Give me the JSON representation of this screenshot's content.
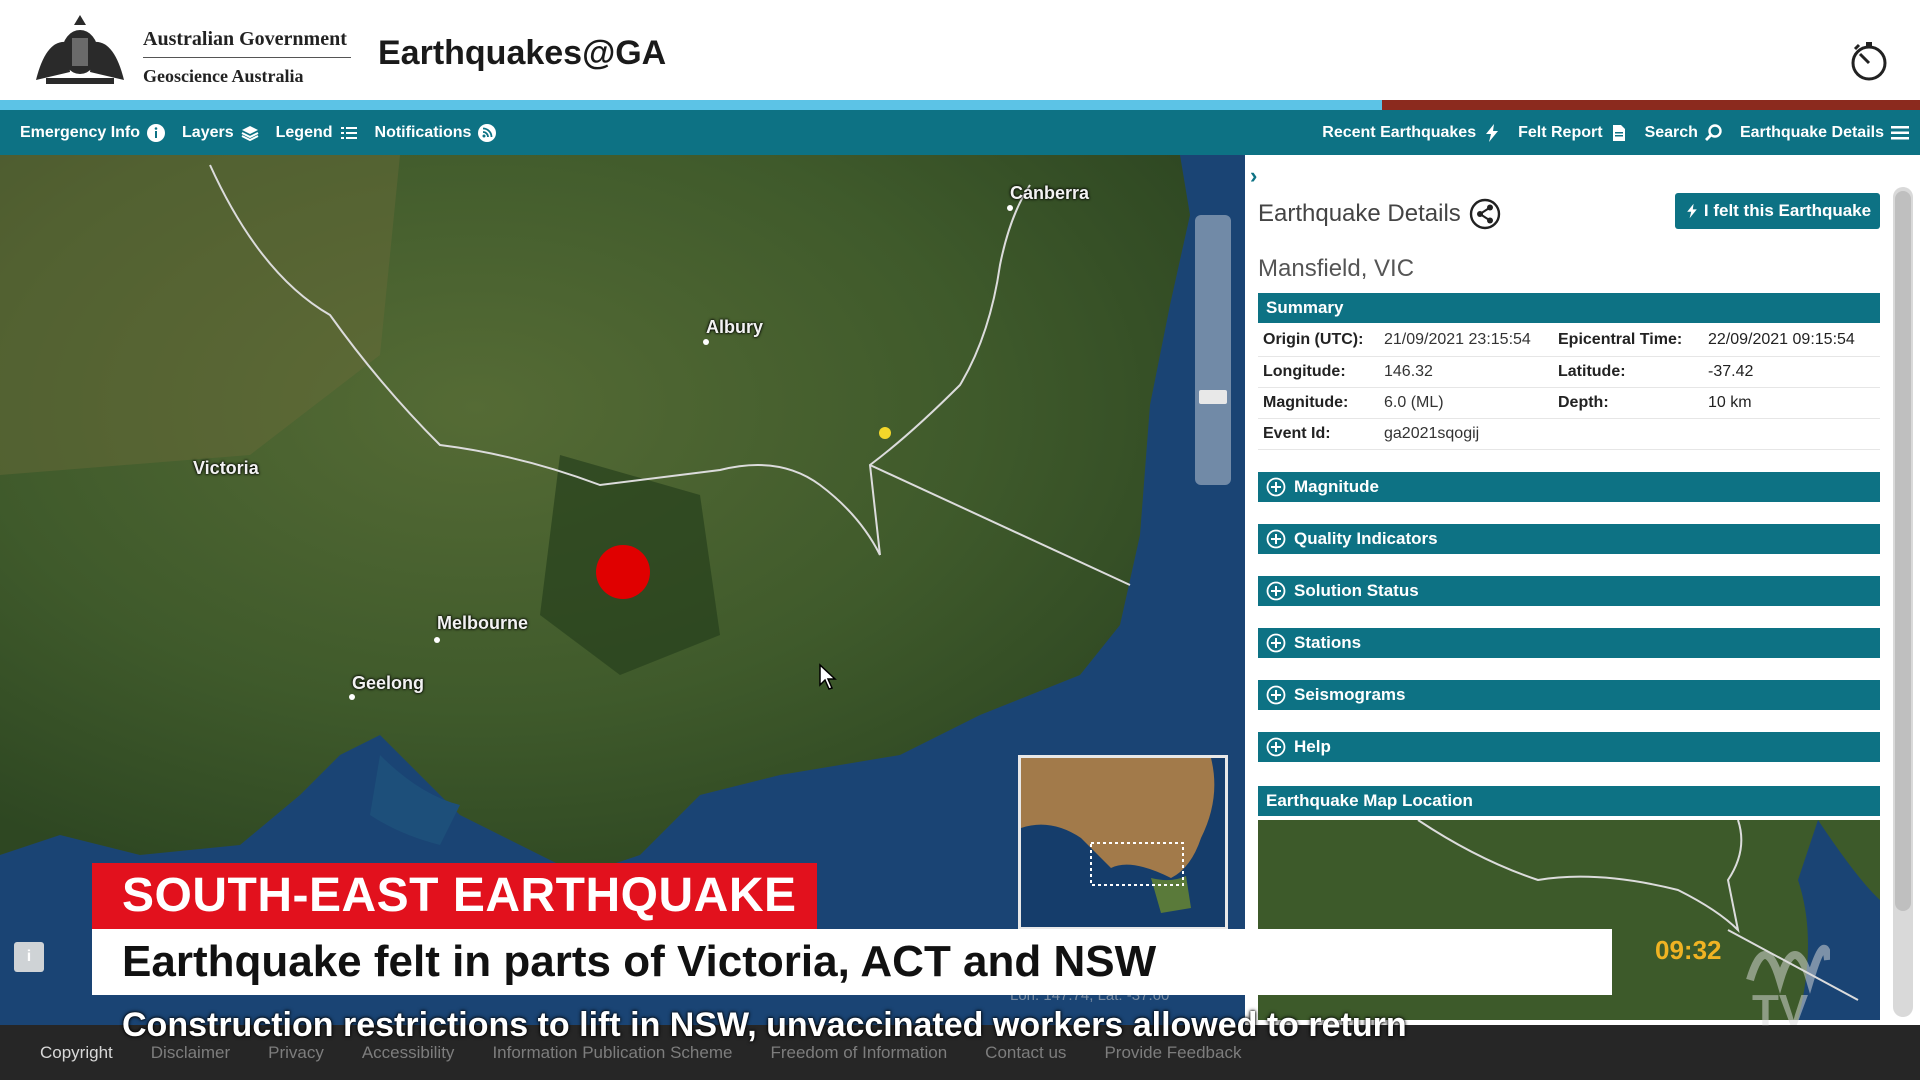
{
  "header": {
    "gov_line1": "Australian Government",
    "gov_line2": "Geoscience Australia",
    "app_title": "Earthquakes@GA",
    "progress_fraction": 0.72
  },
  "nav": {
    "left": [
      {
        "label": "Emergency Info",
        "icon": "info-icon"
      },
      {
        "label": "Layers",
        "icon": "layers-icon"
      },
      {
        "label": "Legend",
        "icon": "list-icon"
      },
      {
        "label": "Notifications",
        "icon": "rss-icon"
      }
    ],
    "right": [
      {
        "label": "Recent Earthquakes",
        "icon": "lightning-icon"
      },
      {
        "label": "Felt Report",
        "icon": "document-icon"
      },
      {
        "label": "Search",
        "icon": "search-icon"
      },
      {
        "label": "Earthquake Details",
        "icon": "menu-icon"
      }
    ]
  },
  "map": {
    "labels": {
      "canberra": "Canberra",
      "albury": "Albury",
      "victoria": "Victoria",
      "melbourne": "Melbourne",
      "geelong": "Geelong"
    },
    "coords_readout": "Lon: 147.74, Lat: -37.60"
  },
  "panel": {
    "title": "Earthquake Details",
    "felt_button": "I felt this Earthquake",
    "location": "Mansfield, VIC",
    "summary_label": "Summary",
    "summary_rows": [
      {
        "k1": "Origin (UTC):",
        "v1": "21/09/2021 23:15:54",
        "k2": "Epicentral Time:",
        "v2": "22/09/2021 09:15:54"
      },
      {
        "k1": "Longitude:",
        "v1": "146.32",
        "k2": "Latitude:",
        "v2": "-37.42"
      },
      {
        "k1": "Magnitude:",
        "v1": "6.0 (ML)",
        "k2": "Depth:",
        "v2": "10 km"
      },
      {
        "k1": "Event Id:",
        "v1": "ga2021sqogij",
        "k2": "",
        "v2": ""
      }
    ],
    "sections": [
      "Magnitude",
      "Quality Indicators",
      "Solution Status",
      "Stations",
      "Seismograms",
      "Help"
    ],
    "map_location_label": "Earthquake Map Location"
  },
  "broadcast": {
    "banner": "SOUTH-EAST EARTHQUAKE",
    "headline": "Earthquake felt in parts of Victoria, ACT and NSW",
    "ticker": "Construction restrictions to lift in NSW, unvaccinated workers allowed to return",
    "clock": "09:32"
  },
  "footer": [
    "Copyright",
    "Disclaimer",
    "Privacy",
    "Accessibility",
    "Information Publication Scheme",
    "Freedom of Information",
    "Contact us",
    "Provide Feedback"
  ],
  "colors": {
    "nav_teal": "#0d7284",
    "banner_red": "#e2111d",
    "epicentre_red": "#e00000",
    "clock_amber": "#f0b323"
  }
}
